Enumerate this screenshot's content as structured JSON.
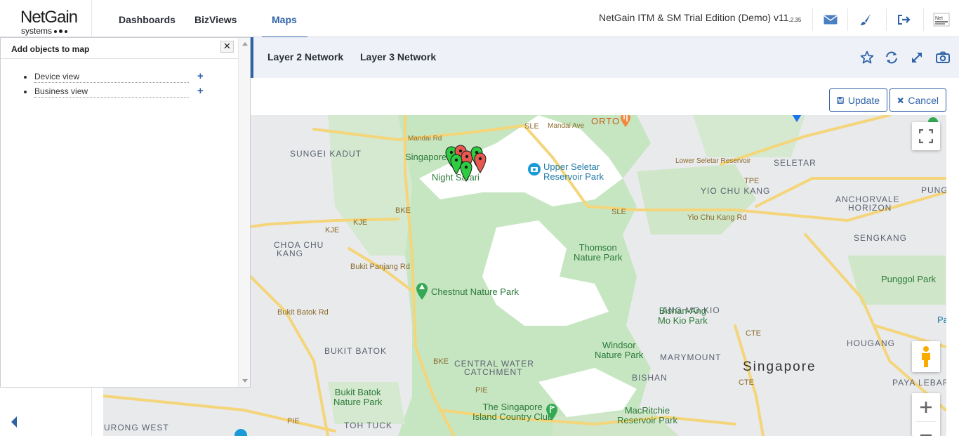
{
  "header": {
    "logo_text": "NetGain",
    "logo_sub": "systems",
    "nav": [
      {
        "label": "Dashboards"
      },
      {
        "label": "BizViews"
      },
      {
        "label": "Maps",
        "active": true
      }
    ],
    "app_title": "NetGain ITM & SM Trial Edition (Demo) v11",
    "app_version_small": ".2.35",
    "icons": [
      "mail-icon",
      "brush-icon",
      "logout-icon",
      "avatar"
    ]
  },
  "layers": {
    "tabs": [
      {
        "label": "Layer 2 Network"
      },
      {
        "label": "Layer 3 Network"
      }
    ],
    "tools": [
      "star-icon",
      "refresh-icon",
      "expand-icon",
      "camera-icon"
    ]
  },
  "actions": {
    "update_label": "Update",
    "cancel_label": "Cancel"
  },
  "panel": {
    "title": "Add objects to map",
    "close_label": "✕",
    "items": [
      {
        "label": "Device view"
      },
      {
        "label": "Business view"
      }
    ],
    "add_label": "+"
  },
  "map": {
    "labels": {
      "mandai_rd": "Mandai Rd",
      "mandai_ave": "Mandai Ave",
      "orto": "ORTO",
      "sungei_kadut": "SUNGEI KADUT",
      "singapore_zoo": "Singapore",
      "night_safari": "Night Safari",
      "upper_seletar": "Upper Seletar",
      "reservoir_park": "Reservoir Park",
      "lower_seletar": "Lower Seletar Reservoir",
      "seletar": "SELETAR",
      "yio_chu_kang": "YIO CHU KANG",
      "pung": "PUNG",
      "anchorvale": "ANCHORVALE",
      "horizon": "HORIZON",
      "sengkang": "SENGKANG",
      "kje": "KJE",
      "kje2": "KJE",
      "sle": "SLE",
      "sle2": "SLE",
      "bke": "BKE",
      "bke2": "BKE",
      "tpe": "TPE",
      "cte": "CTE",
      "cte2": "CTE",
      "pie": "PIE",
      "pie2": "PIE",
      "choa_chu": "CHOA CHU",
      "kang": "KANG",
      "thomson": "Thomson",
      "nature_park": "Nature Park",
      "yio_chu_kang_rd": "Yio Chu Kang Rd",
      "bukit_panjang_rd": "Bukit Panjang Rd",
      "chestnut": "Chestnut Nature Park",
      "punggol_park": "Punggol Park",
      "ang_mo_kio": "ANG MO KIO",
      "bishan_amk": "Bishan-Ang",
      "mo_kio_park": "Mo Kio Park",
      "bukit_batok_rd": "Bukit Batok Rd",
      "bukit_batok": "BUKIT BATOK",
      "central_water": "CENTRAL WATER",
      "catchment": "CATCHMENT",
      "windsor": "Windsor",
      "windsor_park": "Nature Park",
      "marymount": "MARYMOUNT",
      "singapore_big": "Singapore",
      "hougang": "HOUGANG",
      "bishan": "BISHAN",
      "paya_lebar": "PAYA LEBAR",
      "bukit_batok_np": "Bukit Batok",
      "bukit_batok_np2": "Nature Park",
      "toh_tuck": "TOH TUCK",
      "the_singapore": "The Singapore",
      "island_country": "Island Country Club",
      "macritchie": "MacRitchie",
      "macritchie2": "Reservoir Park",
      "urong_west": "URONG WEST",
      "pa": "Pa"
    },
    "pins": [
      {
        "color": "#2ecc40",
        "status": "up"
      },
      {
        "color": "#e8584f",
        "status": "down"
      },
      {
        "color": "#2ecc40",
        "status": "up"
      },
      {
        "color": "#e8584f",
        "status": "down"
      },
      {
        "color": "#2ecc40",
        "status": "up"
      },
      {
        "color": "#2ecc40",
        "status": "up"
      },
      {
        "color": "#e8584f",
        "status": "down"
      }
    ],
    "controls": [
      "fullscreen-icon",
      "pegman-icon",
      "zoom-in-icon",
      "zoom-out-icon"
    ]
  },
  "colors": {
    "accent": "#2f63a8",
    "pin_up": "#2ecc40",
    "pin_down": "#e8584f"
  }
}
